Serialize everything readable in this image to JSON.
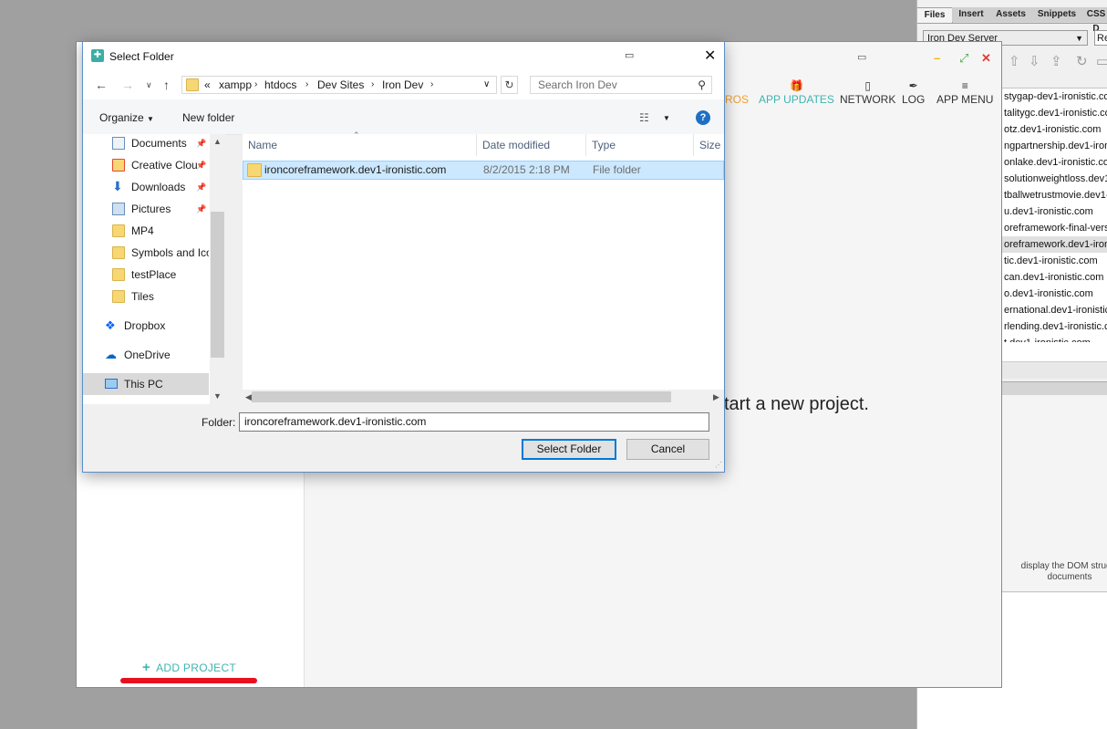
{
  "dw_panel": {
    "tabs": [
      "Files",
      "Insert",
      "Assets",
      "Snippets",
      "CSS D"
    ],
    "site_select": "Iron Dev Server",
    "site_select2": "Re",
    "site_list": [
      "stygap-dev1-ironistic.co",
      "talitygc.dev1-ironistic.co",
      "otz.dev1-ironistic.com",
      "ngpartnership.dev1-iron",
      "onlake.dev1-ironistic.com",
      "solutionweightloss.dev1-",
      "tballwetrustmovie.dev1-",
      "u.dev1-ironistic.com",
      "oreframework-final-versi",
      "oreframework.dev1-iron",
      "tic.dev1-ironistic.com",
      "can.dev1-ironistic.com",
      "o.dev1-ironistic.com",
      "ernational.dev1-ironistic",
      "rlending.dev1-ironistic.c",
      "t.dev1-ironistic.com"
    ],
    "dom_text_line1": "display the DOM structu",
    "dom_text_line2": "documents"
  },
  "app": {
    "nav": {
      "macros_partial": "ROS",
      "app_updates": "APP UPDATES",
      "network": "NETWORK",
      "log": "LOG",
      "app_menu": "APP MENU"
    },
    "start_text": "tart a new project.",
    "add_project": "ADD PROJECT"
  },
  "dialog": {
    "title": "Select Folder",
    "breadcrumb": [
      "«",
      "xampp",
      "htdocs",
      "Dev Sites",
      "Iron Dev"
    ],
    "search_placeholder": "Search Iron Dev",
    "organize": "Organize",
    "new_folder": "New folder",
    "nav_items": [
      {
        "label": "Documents",
        "icon": "documents-icon",
        "pinned": true
      },
      {
        "label": "Creative Clou",
        "icon": "creative-cloud-icon",
        "pinned": true
      },
      {
        "label": "Downloads",
        "icon": "downloads-icon",
        "pinned": true
      },
      {
        "label": "Pictures",
        "icon": "pictures-icon",
        "pinned": true
      },
      {
        "label": "MP4",
        "icon": "folder-icon",
        "pinned": false
      },
      {
        "label": "Symbols and Ico",
        "icon": "folder-icon",
        "pinned": false
      },
      {
        "label": "testPlace",
        "icon": "folder-icon",
        "pinned": false
      },
      {
        "label": "Tiles",
        "icon": "folder-icon",
        "pinned": false
      },
      {
        "label": "Dropbox",
        "icon": "dropbox-icon",
        "pinned": false
      },
      {
        "label": "OneDrive",
        "icon": "onedrive-icon",
        "pinned": false
      },
      {
        "label": "This PC",
        "icon": "this-pc-icon",
        "pinned": false
      }
    ],
    "columns": {
      "name": "Name",
      "date": "Date modified",
      "type": "Type",
      "size": "Size"
    },
    "files": [
      {
        "name": "ironcoreframework.dev1-ironistic.com",
        "date": "8/2/2015 2:18 PM",
        "type": "File folder"
      }
    ],
    "folder_label": "Folder:",
    "folder_value": "ironcoreframework.dev1-ironistic.com",
    "select_button": "Select Folder",
    "cancel_button": "Cancel"
  }
}
